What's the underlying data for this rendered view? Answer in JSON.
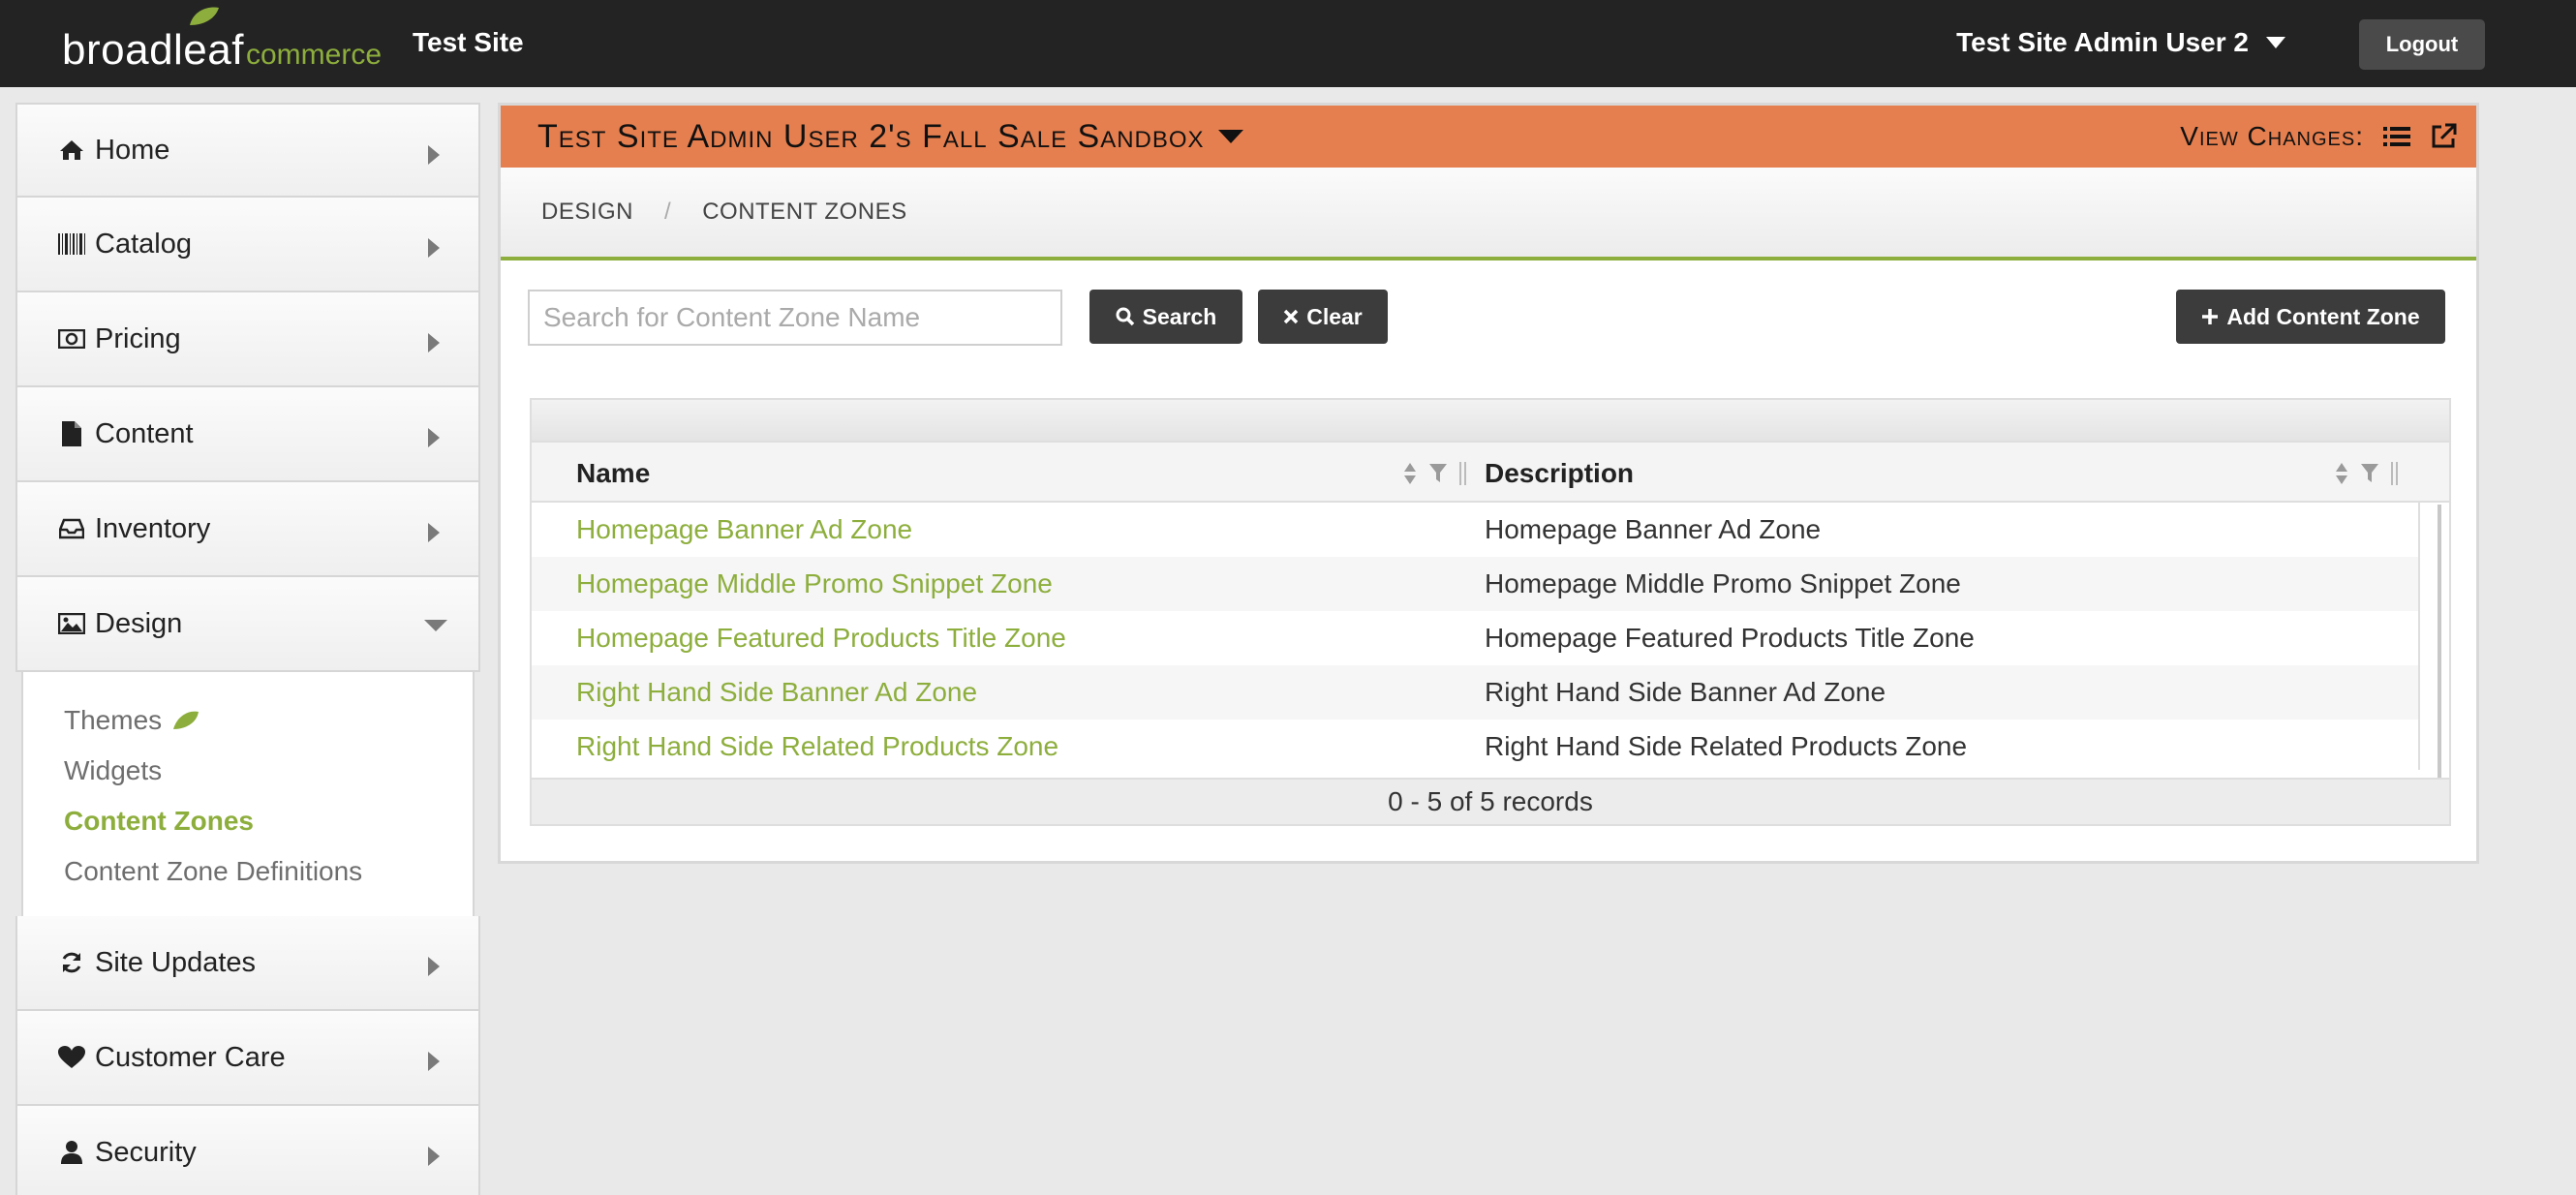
{
  "app": {
    "logo_main": "broadleaf",
    "logo_sub": "commerce",
    "site_name": "Test Site",
    "admin_user": "Test Site Admin User 2",
    "logout_label": "Logout"
  },
  "colors": {
    "brand_green": "#8dae3d",
    "sandbox_orange": "#e67f4f",
    "topbar": "#232323"
  },
  "sidebar": {
    "items": [
      {
        "label": "Home",
        "icon": "home-icon"
      },
      {
        "label": "Catalog",
        "icon": "barcode-icon"
      },
      {
        "label": "Pricing",
        "icon": "money-icon"
      },
      {
        "label": "Content",
        "icon": "file-icon"
      },
      {
        "label": "Inventory",
        "icon": "inbox-icon"
      },
      {
        "label": "Design",
        "icon": "picture-icon",
        "expanded": true
      },
      {
        "label": "Site Updates",
        "icon": "refresh-icon"
      },
      {
        "label": "Customer Care",
        "icon": "heart-icon"
      },
      {
        "label": "Security",
        "icon": "user-icon"
      }
    ],
    "design_subitems": [
      {
        "label": "Themes",
        "icon": "leaf-icon"
      },
      {
        "label": "Widgets"
      },
      {
        "label": "Content Zones",
        "active": true
      },
      {
        "label": "Content Zone Definitions"
      }
    ]
  },
  "sandbox": {
    "title": "Test Site Admin User 2's Fall Sale Sandbox",
    "view_changes_label": "View Changes:"
  },
  "breadcrumb": {
    "items": [
      "Design",
      "Content Zones"
    ],
    "separator": "/"
  },
  "toolbar": {
    "search_placeholder": "Search for Content Zone Name",
    "search_label": "Search",
    "clear_label": "Clear",
    "add_label": "Add Content Zone"
  },
  "grid": {
    "columns": [
      "Name",
      "Description"
    ],
    "rows": [
      {
        "name": "Homepage Banner Ad Zone",
        "description": "Homepage Banner Ad Zone"
      },
      {
        "name": "Homepage Middle Promo Snippet Zone",
        "description": "Homepage Middle Promo Snippet Zone"
      },
      {
        "name": "Homepage Featured Products Title Zone",
        "description": "Homepage Featured Products Title Zone"
      },
      {
        "name": "Right Hand Side Banner Ad Zone",
        "description": "Right Hand Side Banner Ad Zone"
      },
      {
        "name": "Right Hand Side Related Products Zone",
        "description": "Right Hand Side Related Products Zone"
      }
    ],
    "footer": "0 - 5 of 5 records"
  }
}
